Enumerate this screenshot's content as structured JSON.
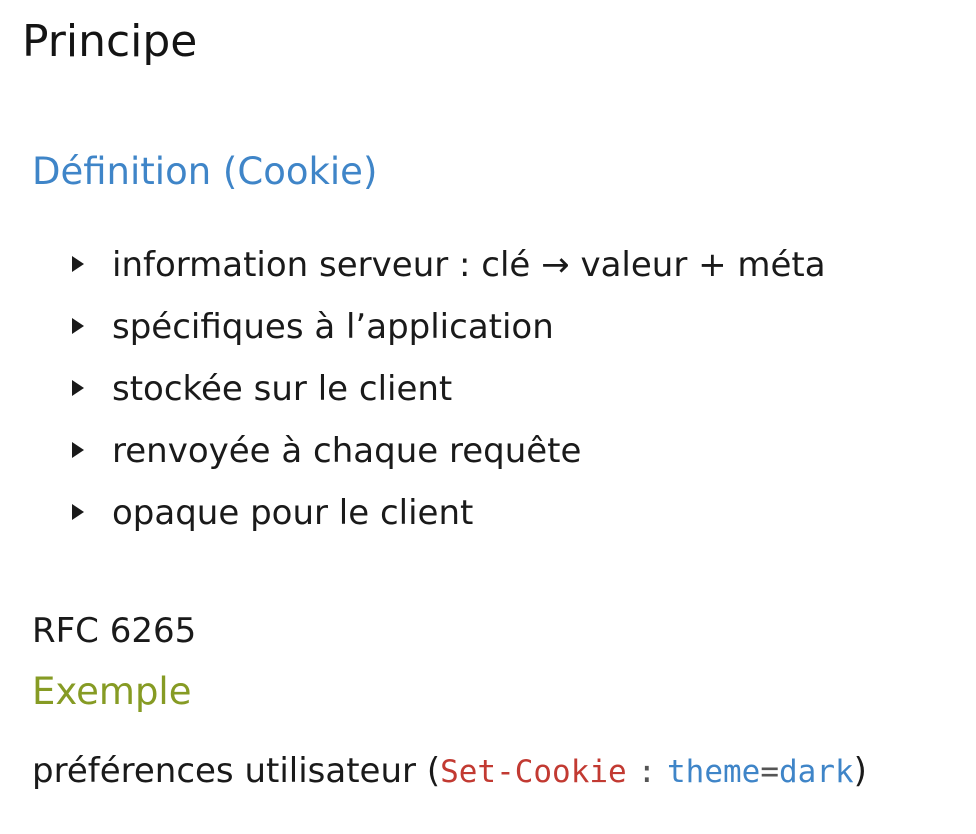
{
  "frame": {
    "title": "Principe"
  },
  "definition": {
    "title": "Définition (Cookie)",
    "items": [
      "information serveur : clé → valeur + méta",
      "spécifiques à l’application",
      "stockée sur le client",
      "renvoyée à chaque requête",
      "opaque pour le client"
    ]
  },
  "rfc": "RFC 6265",
  "example": {
    "title": "Exemple",
    "text": "préférences utilisateur",
    "open_paren": "(",
    "header_name": "Set-Cookie",
    "separator": ":",
    "key": "theme",
    "equals": "=",
    "value": "dark",
    "close_paren": ")"
  },
  "colors": {
    "block_title": "#3f85c8",
    "example_title": "#869b24",
    "code_red": "#c23a32",
    "code_blue": "#3f85c8"
  }
}
